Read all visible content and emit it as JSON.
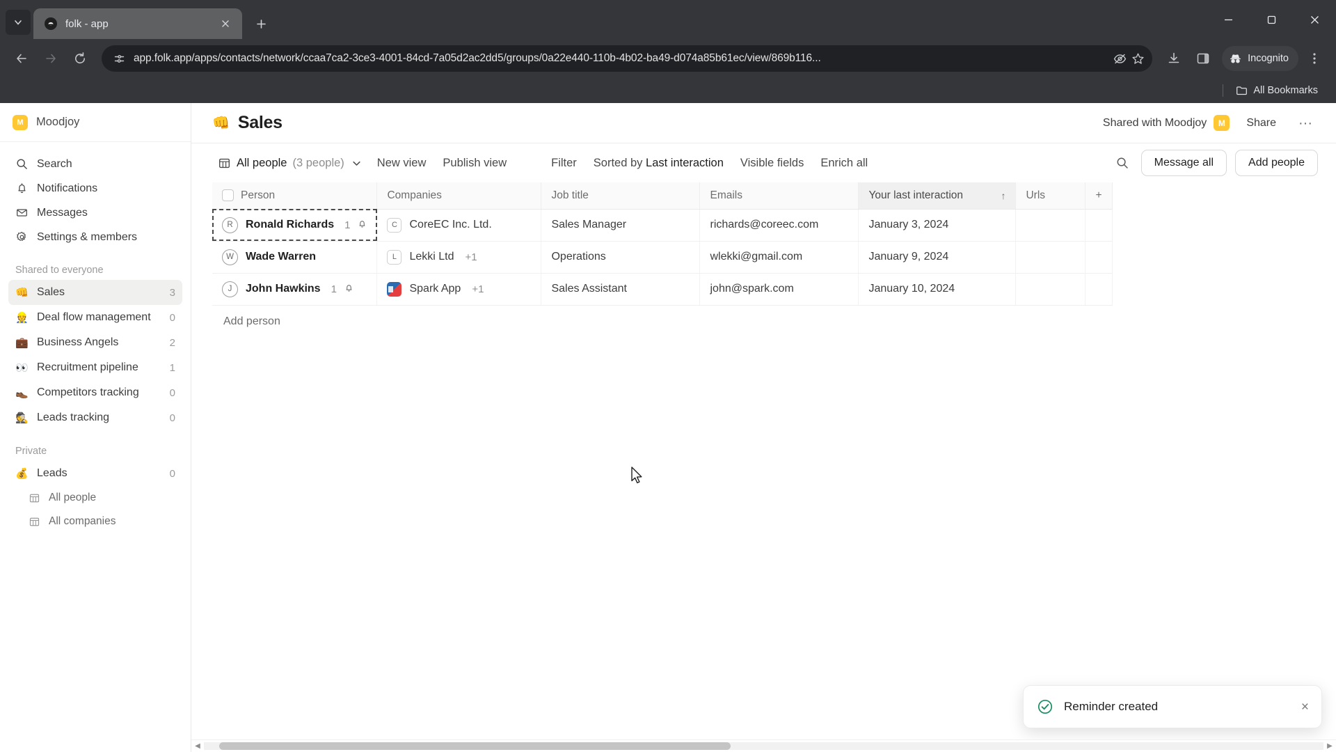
{
  "browser": {
    "tab": {
      "title": "folk - app",
      "favicon": "folk-logo-icon"
    },
    "new_tab_label": "+",
    "url": "app.folk.app/apps/contacts/network/ccaa7ca2-3ce3-4001-84cd-7a05d2ac2dd5/groups/0a22e440-110b-4b02-ba49-d074a85b61ec/view/869b116...",
    "profile_label": "Incognito",
    "bookmarks_label": "All Bookmarks"
  },
  "sidebar": {
    "workspace": {
      "initial": "M",
      "name": "Moodjoy"
    },
    "nav": [
      {
        "label": "Search",
        "icon": "search-icon"
      },
      {
        "label": "Notifications",
        "icon": "bell-icon"
      },
      {
        "label": "Messages",
        "icon": "envelope-icon"
      },
      {
        "label": "Settings & members",
        "icon": "gear-icon"
      }
    ],
    "shared_group_label": "Shared to everyone",
    "shared_items": [
      {
        "emoji": "👊",
        "label": "Sales",
        "count": "3",
        "active": true
      },
      {
        "emoji": "👷",
        "label": "Deal flow management",
        "count": "0",
        "active": false
      },
      {
        "emoji": "💼",
        "label": "Business Angels",
        "count": "2",
        "active": false
      },
      {
        "emoji": "👀",
        "label": "Recruitment pipeline",
        "count": "1",
        "active": false
      },
      {
        "emoji": "👞",
        "label": "Competitors tracking",
        "count": "0",
        "active": false
      },
      {
        "emoji": "🕵️",
        "label": "Leads tracking",
        "count": "0",
        "active": false
      }
    ],
    "private_group_label": "Private",
    "private_items": [
      {
        "emoji": "💰",
        "label": "Leads",
        "count": "0"
      }
    ],
    "sub_items": [
      {
        "label": "All people",
        "icon": "table-icon"
      },
      {
        "label": "All companies",
        "icon": "table-icon"
      }
    ]
  },
  "header": {
    "emoji": "👊",
    "title": "Sales",
    "shared_with": "Shared with Moodjoy",
    "shared_avatar": "M",
    "share_label": "Share",
    "more_label": "···"
  },
  "toolbar": {
    "view_name": "All people",
    "view_count": "(3 people)",
    "new_view": "New view",
    "publish_view": "Publish view",
    "filter": "Filter",
    "sorted_by_prefix": "Sorted by ",
    "sorted_by_field": "Last interaction",
    "visible_fields": "Visible fields",
    "enrich_all": "Enrich all",
    "message_all": "Message all",
    "add_people": "Add people"
  },
  "table": {
    "columns": [
      {
        "label": "Person",
        "sorted": false
      },
      {
        "label": "Companies",
        "sorted": false
      },
      {
        "label": "Job title",
        "sorted": false
      },
      {
        "label": "Emails",
        "sorted": false
      },
      {
        "label": "Your last interaction",
        "sorted": true,
        "sort_dir": "↑"
      },
      {
        "label": "Urls",
        "sorted": false
      }
    ],
    "rows": [
      {
        "avatar": "R",
        "person": "Ronald Richards",
        "reminders": "1",
        "has_bell": true,
        "company_badge": "C",
        "company_badge_type": "letter",
        "company": "CoreEC Inc. Ltd.",
        "company_extra": "",
        "job_title": "Sales Manager",
        "email": "richards@coreec.com",
        "last_interaction": "January 3, 2024",
        "url": "",
        "selected": true
      },
      {
        "avatar": "W",
        "person": "Wade Warren",
        "reminders": "",
        "has_bell": false,
        "company_badge": "L",
        "company_badge_type": "letter",
        "company": "Lekki Ltd",
        "company_extra": "+1",
        "job_title": "Operations",
        "email": "wlekki@gmail.com",
        "last_interaction": "January 9, 2024",
        "url": "",
        "selected": false
      },
      {
        "avatar": "J",
        "person": "John Hawkins",
        "reminders": "1",
        "has_bell": true,
        "company_badge": "",
        "company_badge_type": "image",
        "company": "Spark App",
        "company_extra": "+1",
        "job_title": "Sales Assistant",
        "email": "john@spark.com",
        "last_interaction": "January 10, 2024",
        "url": "",
        "selected": false
      }
    ],
    "add_person_label": "Add person",
    "add_column_label": "+"
  },
  "toast": {
    "message": "Reminder created",
    "icon": "check-circle-icon",
    "close": "×",
    "accent": "#1a8f63"
  }
}
